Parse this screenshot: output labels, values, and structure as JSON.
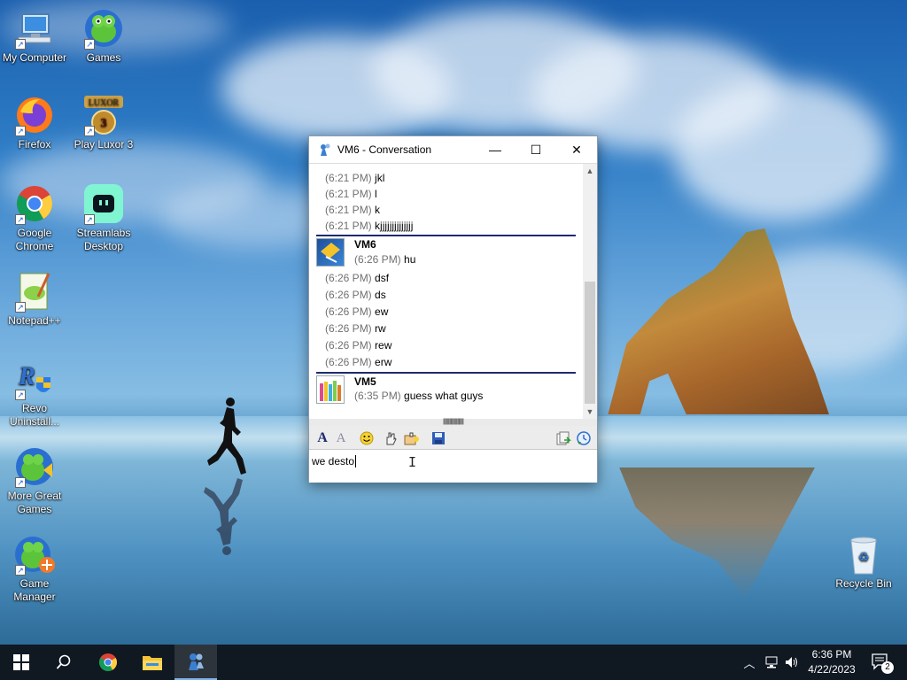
{
  "desktop": {
    "icons": [
      {
        "label": "My Computer"
      },
      {
        "label": "Games"
      },
      {
        "label": "Firefox"
      },
      {
        "label": "Play Luxor 3"
      },
      {
        "label": "Google Chrome"
      },
      {
        "label": "Streamlabs Desktop"
      },
      {
        "label": "Notepad++"
      },
      {
        "label": "Revo Uninstall..."
      },
      {
        "label": "More Great Games"
      },
      {
        "label": "Game Manager"
      },
      {
        "label": "Recycle Bin"
      }
    ],
    "luxor_logo_text": "LUXOR",
    "luxor_number": "3"
  },
  "window": {
    "title": "VM6 - Conversation",
    "minimize_glyph": "—",
    "maximize_glyph": "☐",
    "close_glyph": "✕",
    "messages_top": [
      {
        "time": "(6:21 PM)",
        "text": "jkl"
      },
      {
        "time": "(6:21 PM)",
        "text": "l"
      },
      {
        "time": "(6:21 PM)",
        "text": "k"
      },
      {
        "time": "(6:21 PM)",
        "text": "kjjjjjjjjjjjjjj"
      }
    ],
    "block_vm6": {
      "author": "VM6",
      "first": {
        "time": "(6:26 PM)",
        "text": "hu"
      },
      "messages": [
        {
          "time": "(6:26 PM)",
          "text": "dsf"
        },
        {
          "time": "(6:26 PM)",
          "text": "ds"
        },
        {
          "time": "(6:26 PM)",
          "text": "ew"
        },
        {
          "time": "(6:26 PM)",
          "text": "rw"
        },
        {
          "time": "(6:26 PM)",
          "text": "rew"
        },
        {
          "time": "(6:26 PM)",
          "text": "erw"
        }
      ]
    },
    "block_vm5": {
      "author": "VM5",
      "first": {
        "time": "(6:35 PM)",
        "text": "guess what guys"
      }
    },
    "input_text": "we desto"
  },
  "taskbar": {
    "time": "6:36 PM",
    "date": "4/22/2023",
    "notification_count": "2"
  }
}
